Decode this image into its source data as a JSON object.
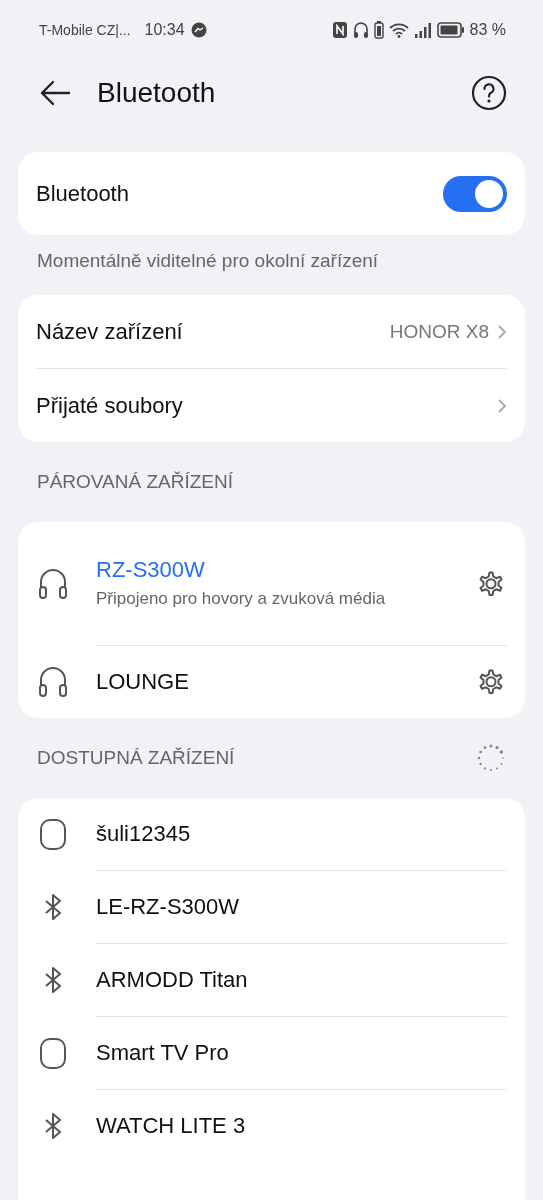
{
  "status_bar": {
    "carrier": "T-Mobile CZ|...",
    "time": "10:34",
    "battery": "83 %"
  },
  "header": {
    "title": "Bluetooth"
  },
  "bluetooth": {
    "label": "Bluetooth",
    "on": true,
    "caption": "Momentálně viditelné pro okolní zařízení"
  },
  "settings": [
    {
      "label": "Název zařízení",
      "value": "HONOR X8"
    },
    {
      "label": "Přijaté soubory"
    }
  ],
  "paired": {
    "heading": "PÁROVANÁ ZAŘÍZENÍ",
    "devices": [
      {
        "kind": "headphones",
        "name": "RZ-S300W",
        "connected": true,
        "status": "Připojeno pro hovory a zvuková média"
      },
      {
        "kind": "headphones",
        "name": "LOUNGE",
        "connected": false
      }
    ]
  },
  "available": {
    "heading": "DOSTUPNÁ ZAŘÍZENÍ",
    "scanning": true,
    "devices": [
      {
        "kind": "speaker",
        "name": "šuli12345"
      },
      {
        "kind": "bluetooth",
        "name": "LE-RZ-S300W"
      },
      {
        "kind": "bluetooth",
        "name": "ARMODD Titan"
      },
      {
        "kind": "speaker",
        "name": "Smart TV Pro"
      },
      {
        "kind": "bluetooth",
        "name": "WATCH LITE 3"
      }
    ]
  }
}
